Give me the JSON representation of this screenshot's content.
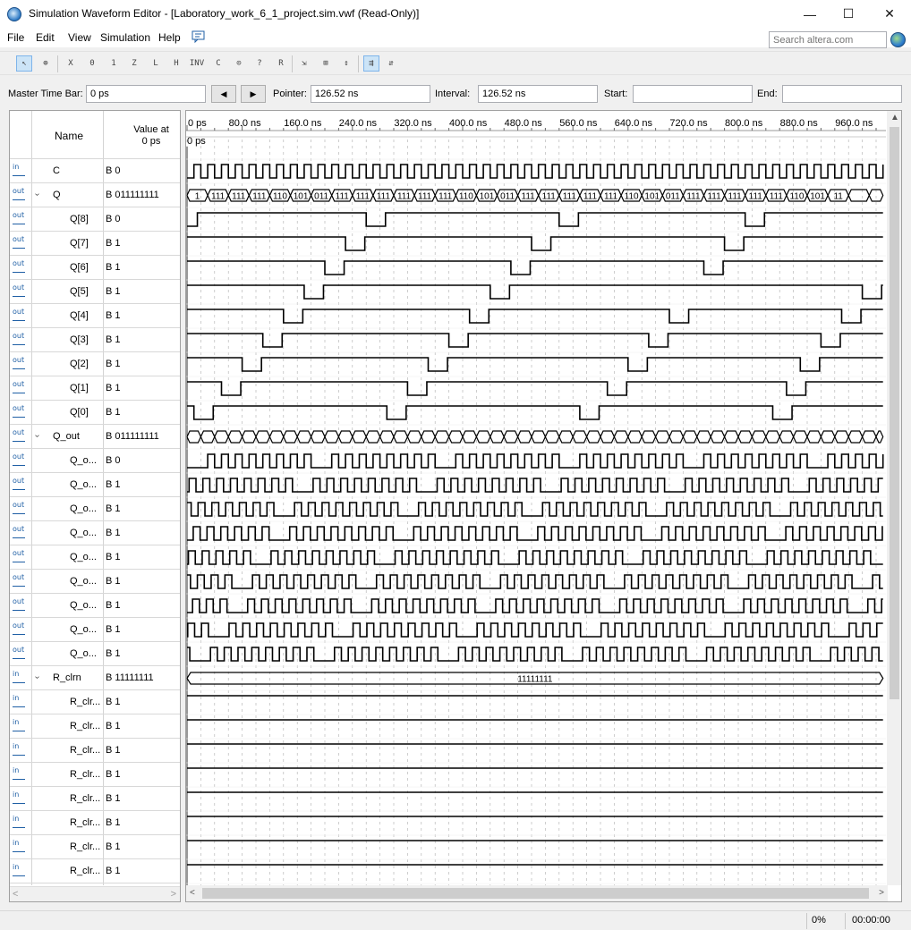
{
  "window": {
    "title": "Simulation Waveform Editor - [Laboratory_work_6_1_project.sim.vwf (Read-Only)]",
    "minimize": "—",
    "maximize": "☐",
    "close": "✕"
  },
  "menu": [
    "File",
    "Edit",
    "View",
    "Simulation",
    "Help"
  ],
  "search": {
    "placeholder": "Search altera.com"
  },
  "toolbar_icons": [
    "selection-tool-icon",
    "zoom-tool-icon",
    "unknown-icon",
    "forcing-low-icon",
    "forcing-high-icon",
    "high-impedance-icon",
    "weak-low-icon",
    "weak-high-icon",
    "invert-icon",
    "count-value-icon",
    "overwrite-clock-icon",
    "random-values-icon",
    "arbitrary-value-icon",
    "snap-to-grid-icon",
    "show-grid-icon",
    "sort-icon",
    "group-icon",
    "ungroup-icon"
  ],
  "timebar": {
    "master_label": "Master Time Bar:",
    "master_value": "0 ps",
    "prev": "◀",
    "next": "▶",
    "pointer_label": "Pointer:",
    "pointer_value": "126.52 ns",
    "interval_label": "Interval:",
    "interval_value": "126.52 ns",
    "start_label": "Start:",
    "start_value": "",
    "end_label": "End:",
    "end_value": ""
  },
  "headers": {
    "name": "Name",
    "value_line1": "Value at",
    "value_line2": "0 ps"
  },
  "time_ticks": [
    "0 ps",
    "80.0 ns",
    "160.0 ns",
    "240.0 ns",
    "320.0 ns",
    "400.0 ns",
    "480.0 ns",
    "560.0 ns",
    "640.0 ns",
    "720.0 ns",
    "800.0 ns",
    "880.0 ns",
    "960.0 ns"
  ],
  "cursor_label": "0 ps",
  "signals": [
    {
      "name": "C",
      "value": "B 0",
      "dir": "in",
      "indent": 1,
      "group": false
    },
    {
      "name": "Q",
      "value": "B 011111111",
      "dir": "out",
      "indent": 0,
      "group": true
    },
    {
      "name": "Q[8]",
      "value": "B 0",
      "dir": "out",
      "indent": 2,
      "group": false
    },
    {
      "name": "Q[7]",
      "value": "B 1",
      "dir": "out",
      "indent": 2,
      "group": false
    },
    {
      "name": "Q[6]",
      "value": "B 1",
      "dir": "out",
      "indent": 2,
      "group": false
    },
    {
      "name": "Q[5]",
      "value": "B 1",
      "dir": "out",
      "indent": 2,
      "group": false
    },
    {
      "name": "Q[4]",
      "value": "B 1",
      "dir": "out",
      "indent": 2,
      "group": false
    },
    {
      "name": "Q[3]",
      "value": "B 1",
      "dir": "out",
      "indent": 2,
      "group": false
    },
    {
      "name": "Q[2]",
      "value": "B 1",
      "dir": "out",
      "indent": 2,
      "group": false
    },
    {
      "name": "Q[1]",
      "value": "B 1",
      "dir": "out",
      "indent": 2,
      "group": false
    },
    {
      "name": "Q[0]",
      "value": "B 1",
      "dir": "out",
      "indent": 2,
      "group": false
    },
    {
      "name": "Q_out",
      "value": "B 011111111",
      "dir": "out",
      "indent": 0,
      "group": true
    },
    {
      "name": "Q_o...",
      "value": "B 0",
      "dir": "out",
      "indent": 2,
      "group": false
    },
    {
      "name": "Q_o...",
      "value": "B 1",
      "dir": "out",
      "indent": 2,
      "group": false
    },
    {
      "name": "Q_o...",
      "value": "B 1",
      "dir": "out",
      "indent": 2,
      "group": false
    },
    {
      "name": "Q_o...",
      "value": "B 1",
      "dir": "out",
      "indent": 2,
      "group": false
    },
    {
      "name": "Q_o...",
      "value": "B 1",
      "dir": "out",
      "indent": 2,
      "group": false
    },
    {
      "name": "Q_o...",
      "value": "B 1",
      "dir": "out",
      "indent": 2,
      "group": false
    },
    {
      "name": "Q_o...",
      "value": "B 1",
      "dir": "out",
      "indent": 2,
      "group": false
    },
    {
      "name": "Q_o...",
      "value": "B 1",
      "dir": "out",
      "indent": 2,
      "group": false
    },
    {
      "name": "Q_o...",
      "value": "B 1",
      "dir": "out",
      "indent": 2,
      "group": false
    },
    {
      "name": "R_clrn",
      "value": "B 11111111",
      "dir": "in",
      "indent": 0,
      "group": true
    },
    {
      "name": "R_clr...",
      "value": "B 1",
      "dir": "in",
      "indent": 2,
      "group": false
    },
    {
      "name": "R_clr...",
      "value": "B 1",
      "dir": "in",
      "indent": 2,
      "group": false
    },
    {
      "name": "R_clr...",
      "value": "B 1",
      "dir": "in",
      "indent": 2,
      "group": false
    },
    {
      "name": "R_clr...",
      "value": "B 1",
      "dir": "in",
      "indent": 2,
      "group": false
    },
    {
      "name": "R_clr...",
      "value": "B 1",
      "dir": "in",
      "indent": 2,
      "group": false
    },
    {
      "name": "R_clr...",
      "value": "B 1",
      "dir": "in",
      "indent": 2,
      "group": false
    },
    {
      "name": "R_clr...",
      "value": "B 1",
      "dir": "in",
      "indent": 2,
      "group": false
    },
    {
      "name": "R_clr...",
      "value": "B 1",
      "dir": "in",
      "indent": 2,
      "group": false
    }
  ],
  "q_bus_labels": [
    "1",
    "111",
    "111",
    "111",
    "110",
    "101",
    "011",
    "111",
    "111",
    "111",
    "111",
    "111",
    "111",
    "110",
    "101",
    "011",
    "111",
    "111",
    "111",
    "111",
    "111",
    "110",
    "101",
    "011",
    "111",
    "111",
    "111",
    "111",
    "111",
    "110",
    "101",
    "11"
  ],
  "r_clrn_bus_label": "11111111",
  "status": {
    "progress": "0%",
    "elapsed": "00:00:00"
  },
  "colors": {
    "wave": "#000000",
    "grid": "#8c8c8c",
    "accent": "#1f5fa5"
  }
}
